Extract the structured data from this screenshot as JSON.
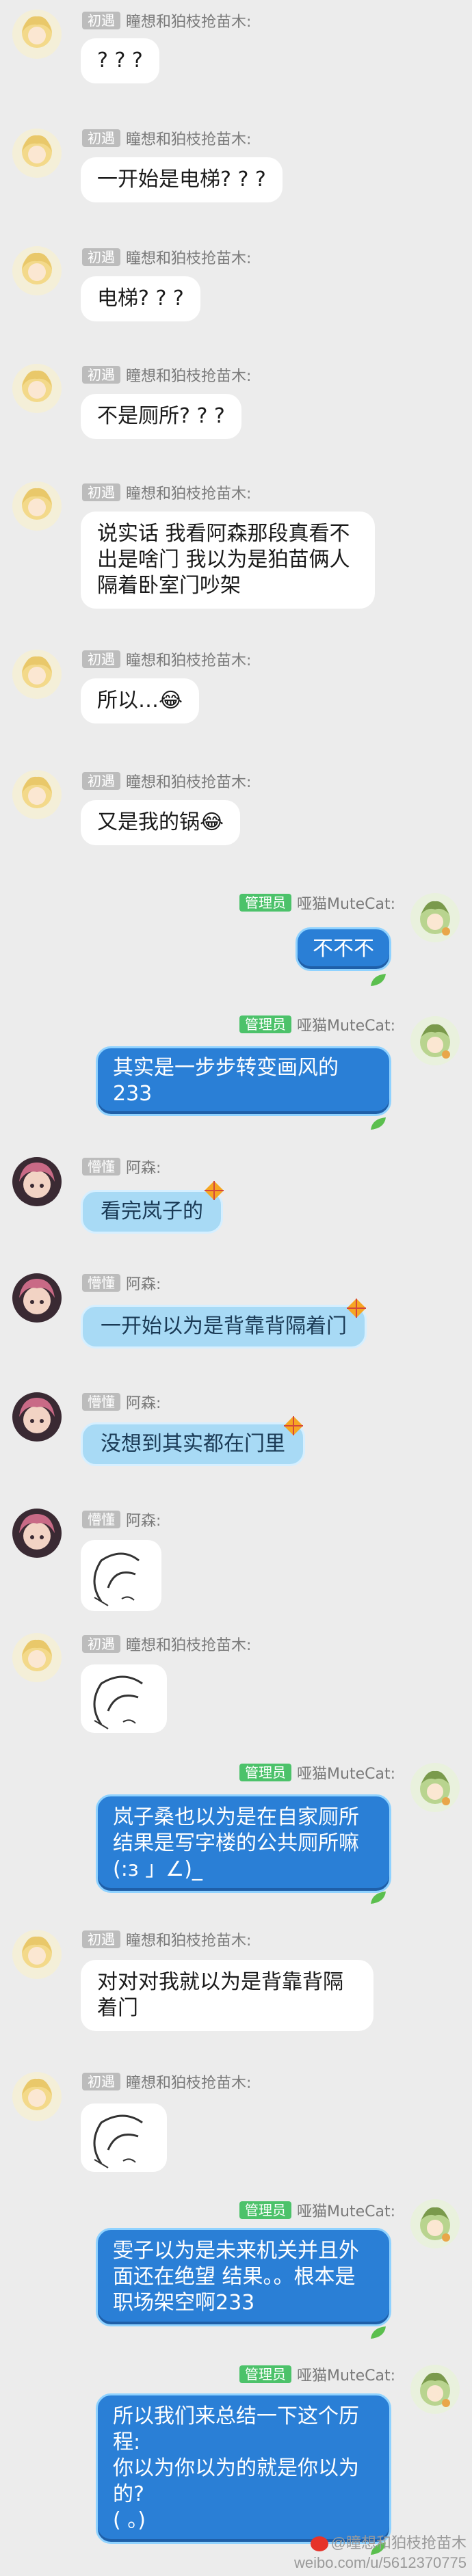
{
  "badges": {
    "member": "初遇",
    "admin": "管理员",
    "newbie": "懵懂"
  },
  "names": {
    "chuyu": "瞳想和狛枝抢苗木:",
    "admin": "哑猫MuteCat:",
    "asen": "阿森:"
  },
  "messages": [
    {
      "text": "? ? ?"
    },
    {
      "text": "一开始是电梯? ? ?"
    },
    {
      "text": "电梯? ? ?"
    },
    {
      "text": "不是厕所? ? ?"
    },
    {
      "lines": [
        "说实话 我看阿森那段真看不",
        "出是啥门 我以为是狛苗俩人",
        "隔着卧室门吵架"
      ]
    },
    {
      "text": "所以…😂"
    },
    {
      "text": "又是我的锅😂"
    },
    {
      "text": "不不不"
    },
    {
      "lines": [
        "其实是一步步转变画风的",
        "233"
      ]
    },
    {
      "text": "看完岚子的"
    },
    {
      "text": "一开始以为是背靠背隔着门"
    },
    {
      "text": "没想到其实都在门里"
    },
    {
      "lines": [
        "岚子桑也以为是在自家厕所",
        "结果是写字楼的公共厕所嘛",
        "(:з 」∠)_"
      ]
    },
    {
      "lines": [
        "对对对我就以为是背靠背隔",
        "着门"
      ]
    },
    {
      "lines": [
        "雯子以为是未来机关并且外",
        "面还在绝望 结果。。根本是",
        "职场架空啊233"
      ]
    },
    {
      "lines": [
        "所以我们来总结一下这个历",
        "程:",
        "你以为你以为的就是你以为",
        "的?",
        "(  。)"
      ]
    }
  ],
  "watermark": {
    "line1": "@瞳想和狛枝抢苗木",
    "line2": "weibo.com/u/5612370775"
  }
}
